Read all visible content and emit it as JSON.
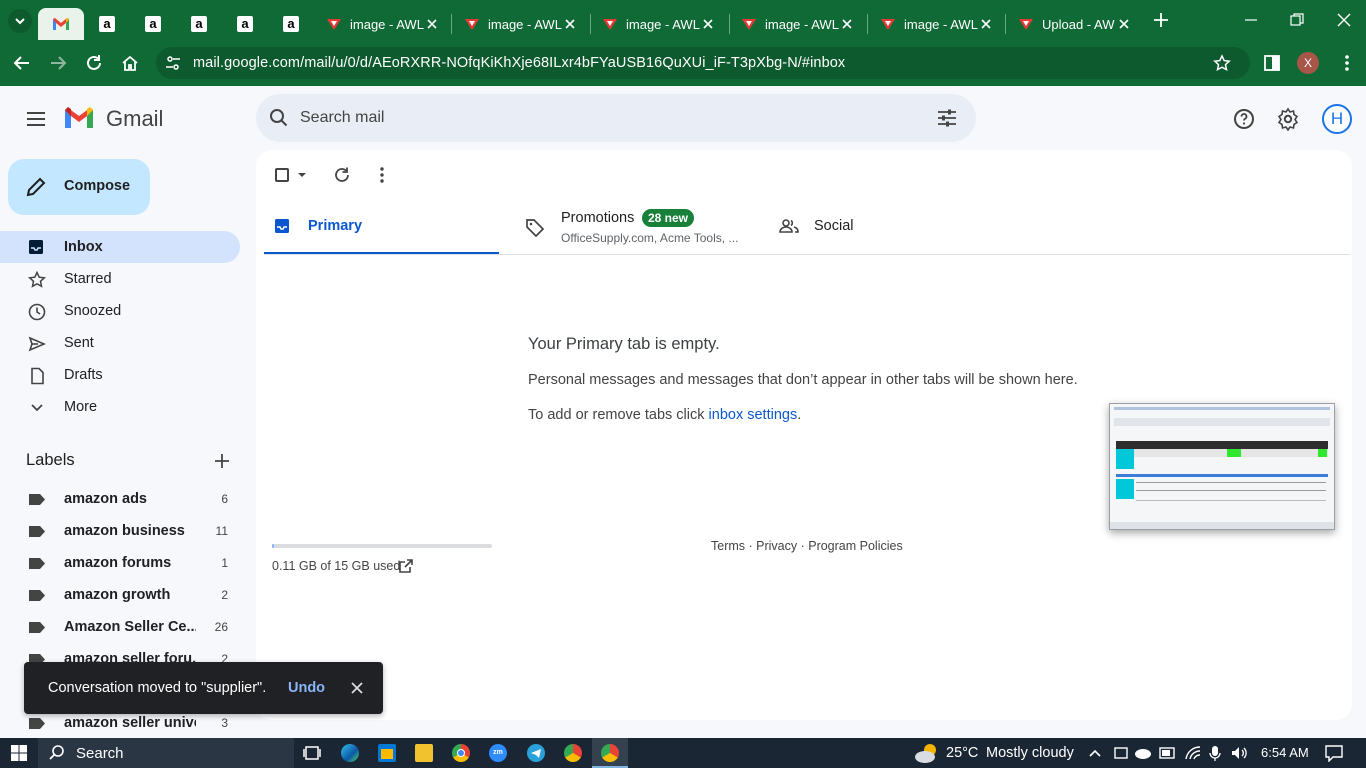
{
  "browser": {
    "tabs": [
      {
        "title": "image - AWL",
        "active": false
      },
      {
        "title": "image - AWL",
        "active": false
      },
      {
        "title": "image - AWL",
        "active": false
      },
      {
        "title": "image - AWL",
        "active": false
      },
      {
        "title": "image - AWL",
        "active": false
      },
      {
        "title": "Upload - AW",
        "active": false
      }
    ],
    "url": "mail.google.com/mail/u/0/d/AEoRXRR-NOfqKiKhXje68ILxr4bFYaUSB16QuXUi_iF-T3pXbg-N/#inbox",
    "profile_initial": "X"
  },
  "gmail": {
    "logo_text": "Gmail",
    "search_placeholder": "Search mail",
    "avatar_initial": "H",
    "compose_label": "Compose",
    "nav": {
      "inbox": "Inbox",
      "starred": "Starred",
      "snoozed": "Snoozed",
      "sent": "Sent",
      "drafts": "Drafts",
      "more": "More"
    },
    "labels_heading": "Labels",
    "labels": [
      {
        "name": "amazon ads",
        "count": "6"
      },
      {
        "name": "amazon business",
        "count": "11"
      },
      {
        "name": "amazon forums",
        "count": "1"
      },
      {
        "name": "amazon growth",
        "count": "2"
      },
      {
        "name": "Amazon Seller Ce...",
        "count": "26"
      },
      {
        "name": "amazon seller foru...",
        "count": "2"
      },
      {
        "name": "amazon seller unive",
        "count": "3"
      }
    ],
    "tabs": {
      "primary": "Primary",
      "promotions": "Promotions",
      "promotions_badge": "28 new",
      "promotions_snippet": "OfficeSupply.com, Acme Tools, ...",
      "social": "Social"
    },
    "empty": {
      "title": "Your Primary tab is empty.",
      "line1": "Personal messages and messages that don’t appear in other tabs will be shown here.",
      "line2_prefix": "To add or remove tabs click ",
      "line2_link": "inbox settings",
      "line2_suffix": "."
    },
    "storage": {
      "text": "0.11 GB of 15 GB used",
      "fraction": 0.0073
    },
    "footer": {
      "terms": "Terms",
      "dot": " · ",
      "privacy": "Privacy",
      "policies": "Program Policies"
    },
    "toast": {
      "message": "Conversation moved to \"supplier\".",
      "undo": "Undo"
    }
  },
  "taskbar": {
    "search_label": "Search",
    "weather_temp": "25°C",
    "weather_text": "Mostly cloudy",
    "time": "6:54 AM"
  },
  "colors": {
    "chrome_green": "#106a36",
    "gmail_bg": "#f6f8fc",
    "accent_blue": "#0b57d0",
    "badge_green": "#188038"
  }
}
